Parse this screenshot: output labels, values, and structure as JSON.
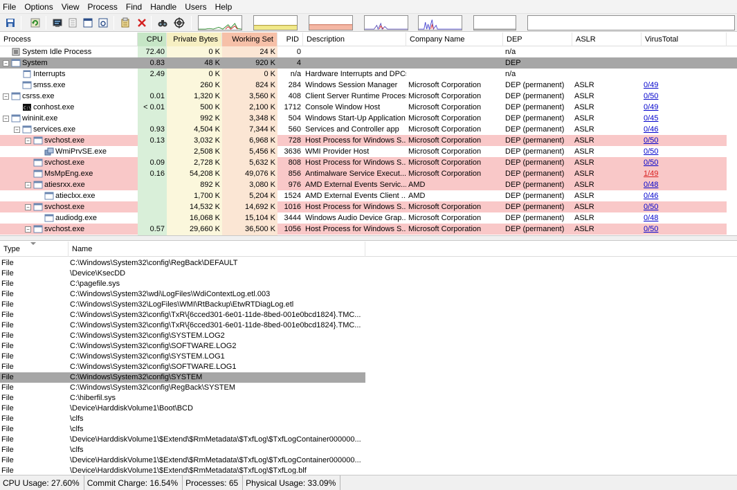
{
  "menu": [
    "File",
    "Options",
    "View",
    "Process",
    "Find",
    "Handle",
    "Users",
    "Help"
  ],
  "toolbar": {
    "buttons": [
      "save-icon",
      "refresh-icon",
      "system-info-icon",
      "properties-icon",
      "window-icon",
      "find-window-icon",
      "process-properties-icon",
      "kill-icon",
      "find-icon",
      "target-icon"
    ]
  },
  "process_table": {
    "columns": [
      "Process",
      "CPU",
      "Private Bytes",
      "Working Set",
      "PID",
      "Description",
      "Company Name",
      "DEP",
      "ASLR",
      "VirusTotal"
    ],
    "colors": {
      "cpu_col": "#d9efd9",
      "private_col": "#fbf7dc",
      "working_col": "#fbe6d4",
      "cpu_header": "#c6e6c6",
      "private_header": "#f6efc2",
      "working_header": "#f6c0a8",
      "service_row": "#f9c8c8",
      "selected_row": "#a6a6a6"
    },
    "rows": [
      {
        "name": "System Idle Process",
        "toggle": "",
        "icon": "cpu-icon",
        "cpu": "72.40",
        "private": "0 K",
        "working": "24 K",
        "pid": "0",
        "description": "",
        "company": "",
        "dep": "n/a",
        "aslr": "",
        "vt": "",
        "style": "normal"
      },
      {
        "name": "System",
        "toggle": "−",
        "icon": "system-icon",
        "cpu": "0.83",
        "private": "48 K",
        "working": "920 K",
        "pid": "4",
        "description": "",
        "company": "",
        "dep": "DEP",
        "aslr": "",
        "vt": "",
        "style": "selected"
      },
      {
        "name": "Interrupts",
        "toggle": "",
        "icon": "interrupts-icon",
        "cpu": "2.49",
        "private": "0 K",
        "working": "0 K",
        "pid": "n/a",
        "description": "Hardware Interrupts and DPCs",
        "company": "",
        "dep": "n/a",
        "aslr": "",
        "vt": "",
        "style": "normal"
      },
      {
        "name": "smss.exe",
        "toggle": "",
        "icon": "exe-icon",
        "cpu": "",
        "private": "260 K",
        "working": "824 K",
        "pid": "284",
        "description": "Windows Session Manager",
        "company": "Microsoft Corporation",
        "dep": "DEP (permanent)",
        "aslr": "ASLR",
        "vt": "0/49",
        "style": "normal"
      },
      {
        "name": "csrss.exe",
        "toggle": "−",
        "icon": "exe-icon",
        "cpu": "0.01",
        "private": "1,320 K",
        "working": "3,560 K",
        "pid": "408",
        "description": "Client Server Runtime Process",
        "company": "Microsoft Corporation",
        "dep": "DEP (permanent)",
        "aslr": "ASLR",
        "vt": "0/50",
        "style": "normal"
      },
      {
        "name": "conhost.exe",
        "toggle": "",
        "icon": "console-icon",
        "cpu": "< 0.01",
        "private": "500 K",
        "working": "2,100 K",
        "pid": "1712",
        "description": "Console Window Host",
        "company": "Microsoft Corporation",
        "dep": "DEP (permanent)",
        "aslr": "ASLR",
        "vt": "0/49",
        "style": "normal"
      },
      {
        "name": "wininit.exe",
        "toggle": "−",
        "icon": "exe-icon",
        "cpu": "",
        "private": "992 K",
        "working": "3,348 K",
        "pid": "504",
        "description": "Windows Start-Up Application",
        "company": "Microsoft Corporation",
        "dep": "DEP (permanent)",
        "aslr": "ASLR",
        "vt": "0/45",
        "style": "normal"
      },
      {
        "name": "services.exe",
        "toggle": "−",
        "icon": "exe-icon",
        "cpu": "0.93",
        "private": "4,504 K",
        "working": "7,344 K",
        "pid": "560",
        "description": "Services and Controller app",
        "company": "Microsoft Corporation",
        "dep": "DEP (permanent)",
        "aslr": "ASLR",
        "vt": "0/46",
        "style": "normal"
      },
      {
        "name": "svchost.exe",
        "toggle": "−",
        "icon": "exe-icon",
        "cpu": "0.13",
        "private": "3,032 K",
        "working": "6,968 K",
        "pid": "728",
        "description": "Host Process for Windows S...",
        "company": "Microsoft Corporation",
        "dep": "DEP (permanent)",
        "aslr": "ASLR",
        "vt": "0/50",
        "style": "service"
      },
      {
        "name": "WmiPrvSE.exe",
        "toggle": "",
        "icon": "wmi-icon",
        "cpu": "",
        "private": "2,508 K",
        "working": "5,456 K",
        "pid": "3636",
        "description": "WMI Provider Host",
        "company": "Microsoft Corporation",
        "dep": "DEP (permanent)",
        "aslr": "ASLR",
        "vt": "0/50",
        "style": "normal"
      },
      {
        "name": "svchost.exe",
        "toggle": "",
        "icon": "exe-icon",
        "cpu": "0.09",
        "private": "2,728 K",
        "working": "5,632 K",
        "pid": "808",
        "description": "Host Process for Windows S...",
        "company": "Microsoft Corporation",
        "dep": "DEP (permanent)",
        "aslr": "ASLR",
        "vt": "0/50",
        "style": "service"
      },
      {
        "name": "MsMpEng.exe",
        "toggle": "",
        "icon": "exe-icon",
        "cpu": "0.16",
        "private": "54,208 K",
        "working": "49,076 K",
        "pid": "856",
        "description": "Antimalware Service Execut...",
        "company": "Microsoft Corporation",
        "dep": "DEP (permanent)",
        "aslr": "ASLR",
        "vt": "1/49",
        "vt_bad": true,
        "style": "service"
      },
      {
        "name": "atiesrxx.exe",
        "toggle": "−",
        "icon": "exe-icon",
        "cpu": "",
        "private": "892 K",
        "working": "3,080 K",
        "pid": "976",
        "description": "AMD External Events Servic...",
        "company": "AMD",
        "dep": "DEP (permanent)",
        "aslr": "ASLR",
        "vt": "0/48",
        "style": "service"
      },
      {
        "name": "atieclxx.exe",
        "toggle": "",
        "icon": "exe-icon",
        "cpu": "",
        "private": "1,700 K",
        "working": "5,204 K",
        "pid": "1524",
        "description": "AMD External Events Client ...",
        "company": "AMD",
        "dep": "DEP (permanent)",
        "aslr": "ASLR",
        "vt": "0/46",
        "style": "normal"
      },
      {
        "name": "svchost.exe",
        "toggle": "−",
        "icon": "exe-icon",
        "cpu": "",
        "private": "14,532 K",
        "working": "14,692 K",
        "pid": "1016",
        "description": "Host Process for Windows S...",
        "company": "Microsoft Corporation",
        "dep": "DEP (permanent)",
        "aslr": "ASLR",
        "vt": "0/50",
        "style": "service"
      },
      {
        "name": "audiodg.exe",
        "toggle": "",
        "icon": "exe-icon",
        "cpu": "",
        "private": "16,068 K",
        "working": "15,104 K",
        "pid": "3444",
        "description": "Windows Audio Device Grap...",
        "company": "Microsoft Corporation",
        "dep": "DEP (permanent)",
        "aslr": "ASLR",
        "vt": "0/48",
        "style": "normal"
      },
      {
        "name": "svchost.exe",
        "toggle": "−",
        "icon": "exe-icon",
        "cpu": "0.57",
        "private": "29,660 K",
        "working": "36,500 K",
        "pid": "1056",
        "description": "Host Process for Windows S...",
        "company": "Microsoft Corporation",
        "dep": "DEP (permanent)",
        "aslr": "ASLR",
        "vt": "0/50",
        "style": "service"
      }
    ]
  },
  "handle_table": {
    "columns": [
      "Type",
      "Name"
    ],
    "rows": [
      {
        "type": "File",
        "name": "C:\\Windows\\System32\\config\\RegBack\\DEFAULT"
      },
      {
        "type": "File",
        "name": "\\Device\\KsecDD"
      },
      {
        "type": "File",
        "name": "C:\\pagefile.sys"
      },
      {
        "type": "File",
        "name": "C:\\Windows\\System32\\wdi\\LogFiles\\WdiContextLog.etl.003"
      },
      {
        "type": "File",
        "name": "C:\\Windows\\System32\\LogFiles\\WMI\\RtBackup\\EtwRTDiagLog.etl"
      },
      {
        "type": "File",
        "name": "C:\\Windows\\System32\\config\\TxR\\{6cced301-6e01-11de-8bed-001e0bcd1824}.TMC..."
      },
      {
        "type": "File",
        "name": "C:\\Windows\\System32\\config\\TxR\\{6cced301-6e01-11de-8bed-001e0bcd1824}.TMC..."
      },
      {
        "type": "File",
        "name": "C:\\Windows\\System32\\config\\SYSTEM.LOG2"
      },
      {
        "type": "File",
        "name": "C:\\Windows\\System32\\config\\SOFTWARE.LOG2"
      },
      {
        "type": "File",
        "name": "C:\\Windows\\System32\\config\\SYSTEM.LOG1"
      },
      {
        "type": "File",
        "name": "C:\\Windows\\System32\\config\\SOFTWARE.LOG1"
      },
      {
        "type": "File",
        "name": "C:\\Windows\\System32\\config\\SYSTEM",
        "selected": true
      },
      {
        "type": "File",
        "name": "C:\\Windows\\System32\\config\\RegBack\\SYSTEM"
      },
      {
        "type": "File",
        "name": "C:\\hiberfil.sys"
      },
      {
        "type": "File",
        "name": "\\Device\\HarddiskVolume1\\Boot\\BCD"
      },
      {
        "type": "File",
        "name": "\\clfs"
      },
      {
        "type": "File",
        "name": "\\clfs"
      },
      {
        "type": "File",
        "name": "\\Device\\HarddiskVolume1\\$Extend\\$RmMetadata\\$TxfLog\\$TxfLogContainer000000..."
      },
      {
        "type": "File",
        "name": "\\clfs"
      },
      {
        "type": "File",
        "name": "\\Device\\HarddiskVolume1\\$Extend\\$RmMetadata\\$TxfLog\\$TxfLogContainer000000..."
      },
      {
        "type": "File",
        "name": "\\Device\\HarddiskVolume1\\$Extend\\$RmMetadata\\$TxfLog\\$TxfLog.blf"
      }
    ],
    "selected_color": "#a6a6a6"
  },
  "status": {
    "cpu": "CPU Usage: 27.60%",
    "commit": "Commit Charge: 16.54%",
    "processes": "Processes: 65",
    "physical": "Physical Usage: 33.09%"
  }
}
